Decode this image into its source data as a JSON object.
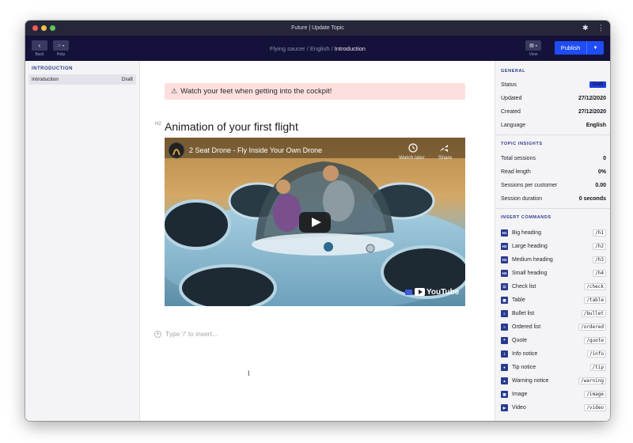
{
  "window": {
    "title": "Future | Update Topic"
  },
  "header": {
    "back_label": "Back",
    "help_label": "Help",
    "view_label": "View",
    "breadcrumb": {
      "part1": "Flying saucer",
      "part2": "English",
      "current": "Introduction"
    },
    "publish_label": "Publish"
  },
  "sidebar": {
    "heading": "INTRODUCTION",
    "items": [
      {
        "label": "Introduction",
        "badge": "Draft"
      }
    ]
  },
  "editor": {
    "notice": "Watch your feet when getting into the cockpit!",
    "heading_tag": "H2",
    "heading": "Animation of your first flight",
    "video": {
      "title": "2 Seat Drone - Fly Inside Your Own Drone",
      "watch_later": "Watch later",
      "share": "Share",
      "brand": "YouTube"
    },
    "insert_placeholder": "Type '/' to insert..."
  },
  "general": {
    "heading": "GENERAL",
    "rows": [
      {
        "label": "Status",
        "value": "Draft"
      },
      {
        "label": "Updated",
        "value": "27/12/2020"
      },
      {
        "label": "Created",
        "value": "27/12/2020"
      },
      {
        "label": "Language",
        "value": "English"
      }
    ]
  },
  "insights": {
    "heading": "TOPIC INSIGHTS",
    "rows": [
      {
        "label": "Total sessions",
        "value": "0"
      },
      {
        "label": "Read length",
        "value": "0%"
      },
      {
        "label": "Sessions per customer",
        "value": "0.00"
      },
      {
        "label": "Session duration",
        "value": "0 seconds"
      }
    ]
  },
  "commands": {
    "heading": "INSERT COMMANDS",
    "items": [
      {
        "icon": "H1",
        "label": "Big heading",
        "shortcut": "/h1"
      },
      {
        "icon": "H2",
        "label": "Large heading",
        "shortcut": "/h2"
      },
      {
        "icon": "H3",
        "label": "Medium heading",
        "shortcut": "/h3"
      },
      {
        "icon": "H4",
        "label": "Small heading",
        "shortcut": "/h4"
      },
      {
        "icon": "☑",
        "label": "Check list",
        "shortcut": "/check"
      },
      {
        "icon": "▦",
        "label": "Table",
        "shortcut": "/table"
      },
      {
        "icon": "≡",
        "label": "Bullet list",
        "shortcut": "/bullet"
      },
      {
        "icon": "≡",
        "label": "Ordered list",
        "shortcut": "/ordered"
      },
      {
        "icon": "❝",
        "label": "Quote",
        "shortcut": "/quote"
      },
      {
        "icon": "i",
        "label": "Info notice",
        "shortcut": "/info"
      },
      {
        "icon": "●",
        "label": "Tip notice",
        "shortcut": "/tip"
      },
      {
        "icon": "▲",
        "label": "Warning notice",
        "shortcut": "/warning"
      },
      {
        "icon": "▣",
        "label": "Image",
        "shortcut": "/image"
      },
      {
        "icon": "▶",
        "label": "Video",
        "shortcut": "/video"
      }
    ]
  }
}
